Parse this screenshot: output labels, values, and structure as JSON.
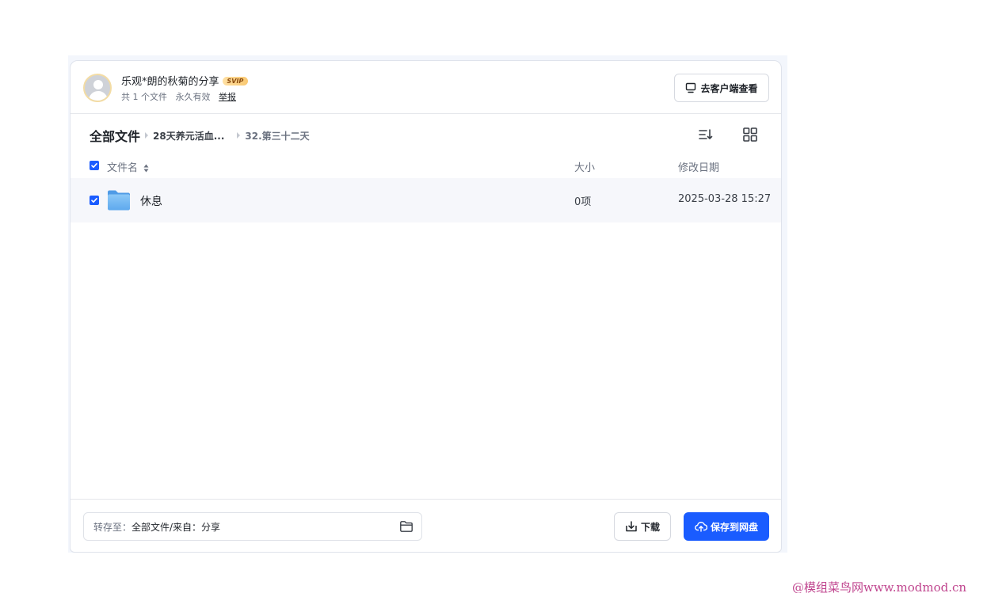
{
  "share": {
    "title": "乐观*朗的秋菊的分享",
    "badge": "SVIP",
    "file_count": "共 1 个文件",
    "validity": "永久有效",
    "report": "举报",
    "client_button": "去客户端查看"
  },
  "breadcrumb": {
    "root": "全部文件",
    "items": [
      "28天养元活血...",
      "32.第三十二天"
    ]
  },
  "table": {
    "columns": {
      "name": "文件名",
      "size": "大小",
      "date": "修改日期"
    },
    "rows": [
      {
        "name": "休息",
        "size": "0项",
        "date": "2025-03-28 15:27",
        "checked": true,
        "icon": "folder-icon"
      }
    ],
    "all_checked": true
  },
  "footer": {
    "save_label": "转存至：",
    "save_value": "全部文件/来自：分享",
    "download": "下载",
    "save_to_drive": "保存到网盘"
  },
  "colors": {
    "accent": "#1a5cff",
    "watermark": "#c0468f"
  },
  "watermark": "@模组菜鸟网www.modmod.cn"
}
